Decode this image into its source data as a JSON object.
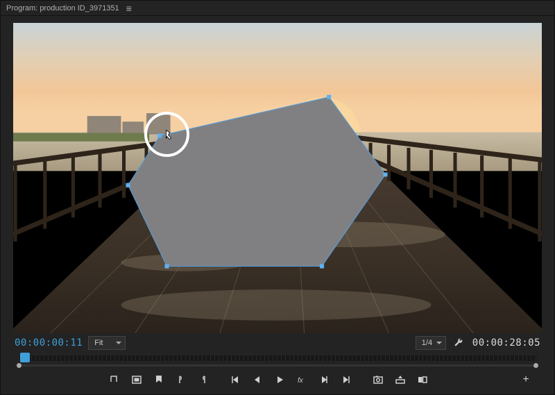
{
  "titlebar": {
    "prefix": "Program:",
    "sequence": "production ID_3971351"
  },
  "timecode": {
    "current": "00:00:00:11",
    "duration": "00:00:28:05"
  },
  "zoom": {
    "label": "Fit"
  },
  "resolution": {
    "label": "1/4"
  },
  "playhead_pct": 1.2,
  "shape": {
    "fill": "#808083"
  }
}
